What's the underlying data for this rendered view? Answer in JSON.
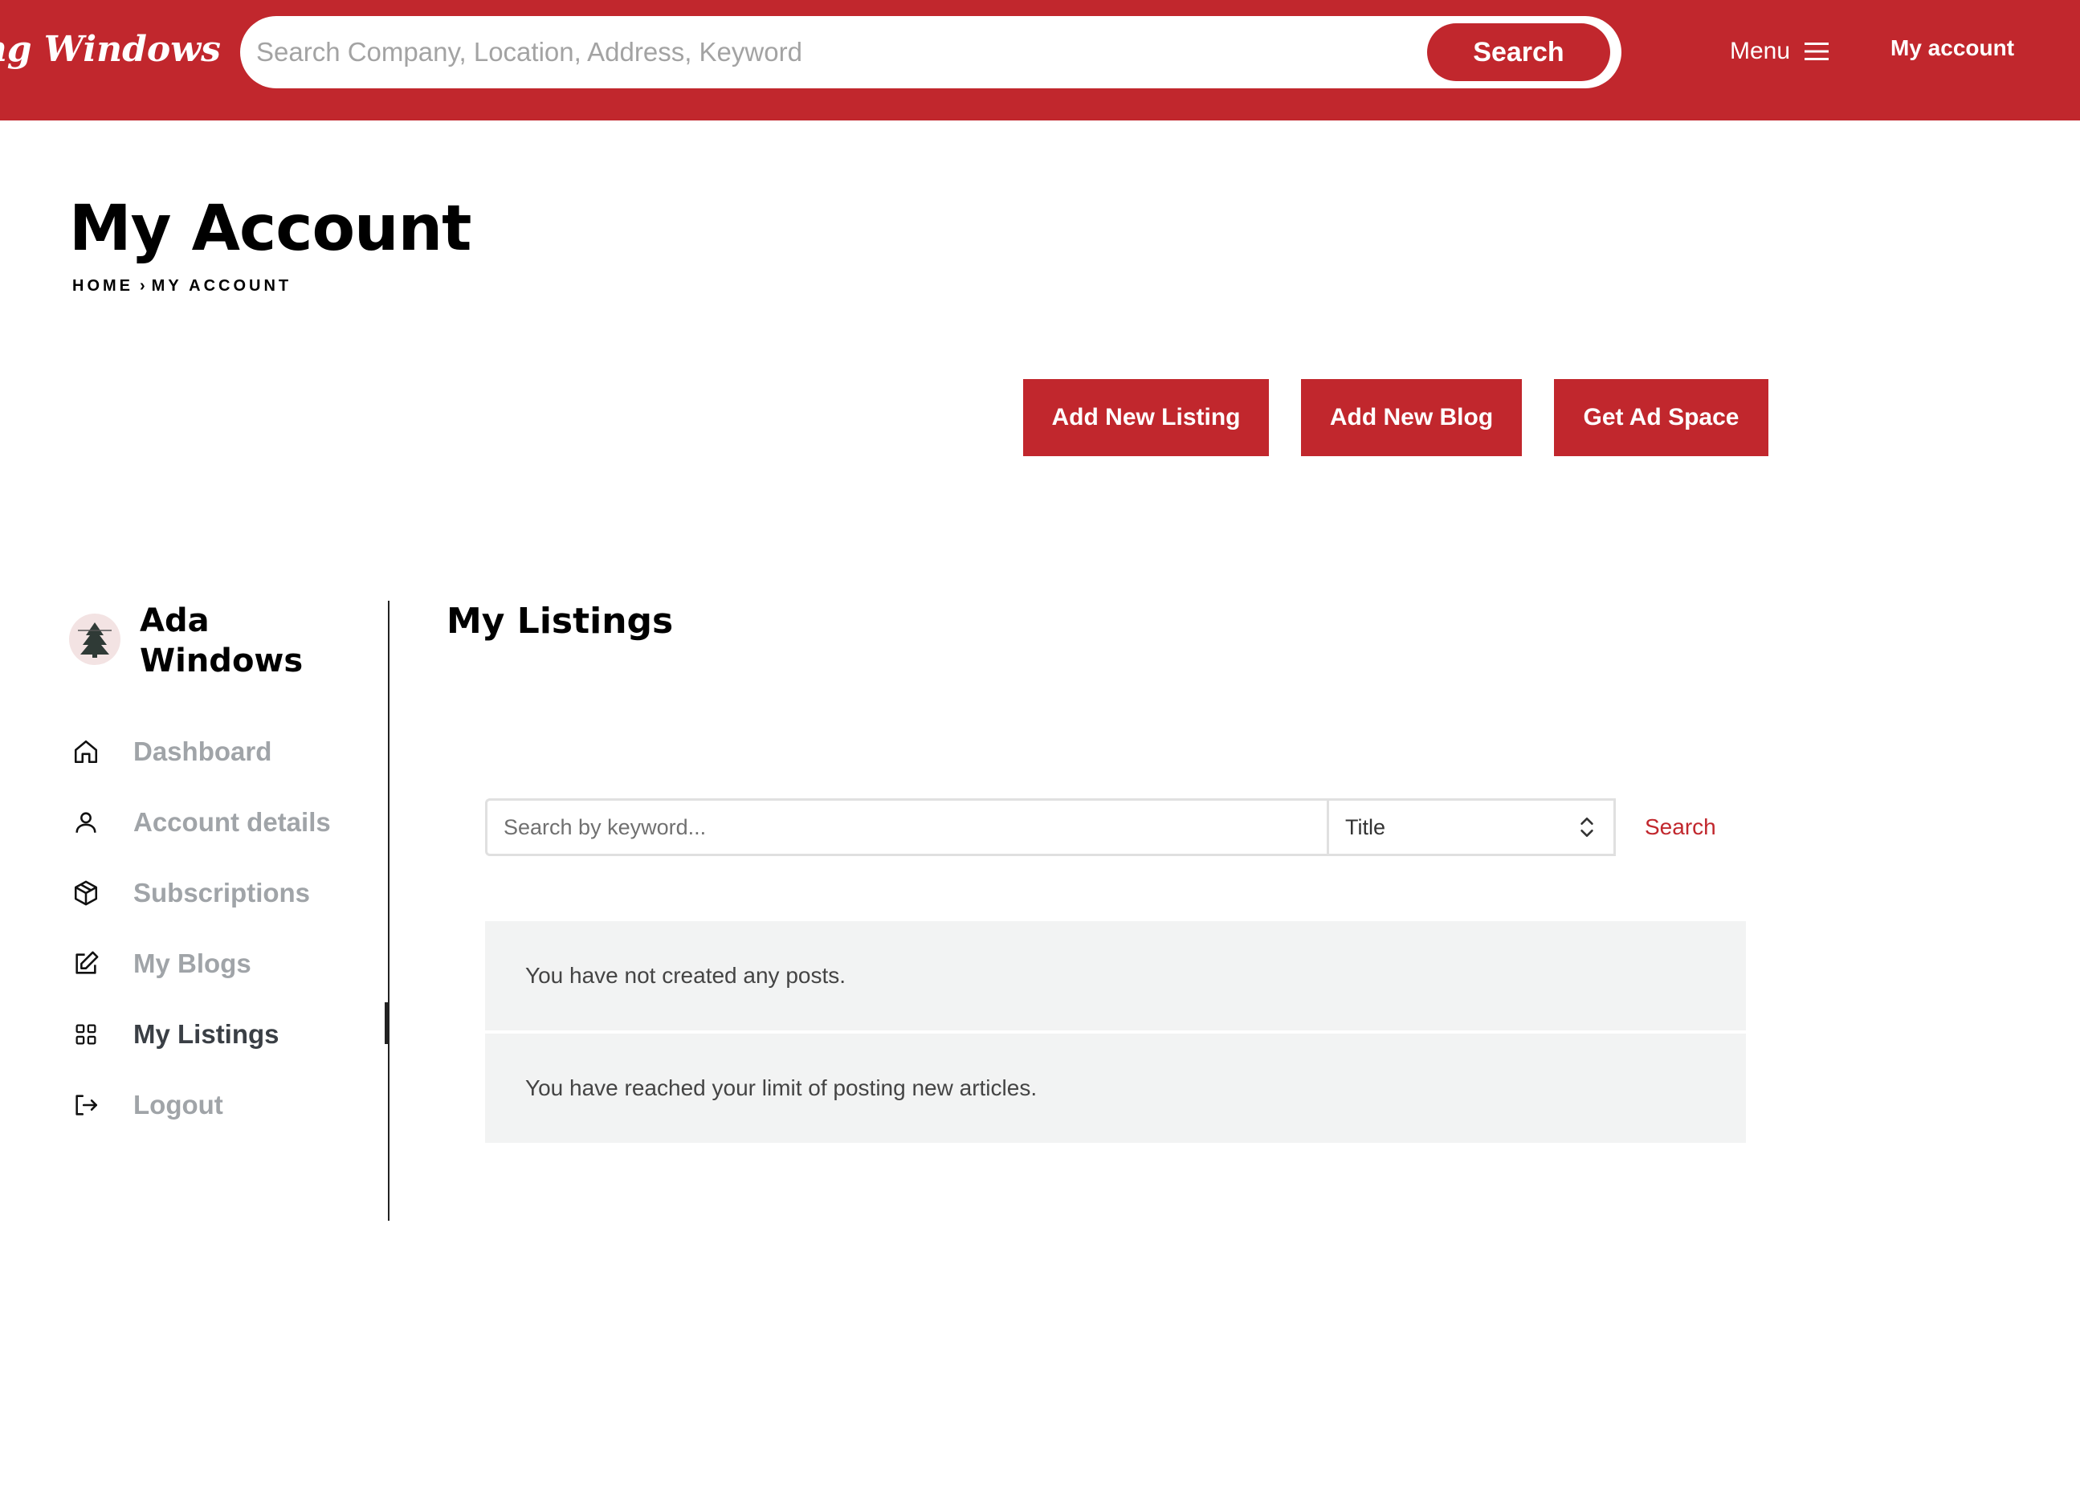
{
  "header": {
    "logo_text": "ing Windows",
    "search_placeholder": "Search Company, Location, Address, Keyword",
    "search_button": "Search",
    "menu_label": "Menu",
    "account_label": "My account"
  },
  "page": {
    "title": "My Account",
    "breadcrumb": {
      "home": "HOME",
      "separator": "›",
      "current": "MY ACCOUNT"
    }
  },
  "actions": {
    "add_listing": "Add New Listing",
    "add_blog": "Add New Blog",
    "get_ad_space": "Get Ad Space"
  },
  "sidebar": {
    "user_name": "Ada Windows",
    "items": [
      {
        "label": "Dashboard",
        "icon": "home-icon"
      },
      {
        "label": "Account details",
        "icon": "user-icon"
      },
      {
        "label": "Subscriptions",
        "icon": "package-icon"
      },
      {
        "label": "My Blogs",
        "icon": "edit-icon"
      },
      {
        "label": "My Listings",
        "icon": "grid-icon",
        "active": true
      },
      {
        "label": "Logout",
        "icon": "logout-icon"
      }
    ]
  },
  "main": {
    "section_title": "My Listings",
    "filter": {
      "keyword_placeholder": "Search by keyword...",
      "field_selected": "Title",
      "search_label": "Search"
    },
    "notices": [
      "You have not created any posts.",
      "You have reached your limit of posting new articles."
    ]
  },
  "colors": {
    "brand_red": "#c1272d",
    "notice_bg": "#f2f3f3",
    "nav_inactive": "#a0a4a8"
  }
}
